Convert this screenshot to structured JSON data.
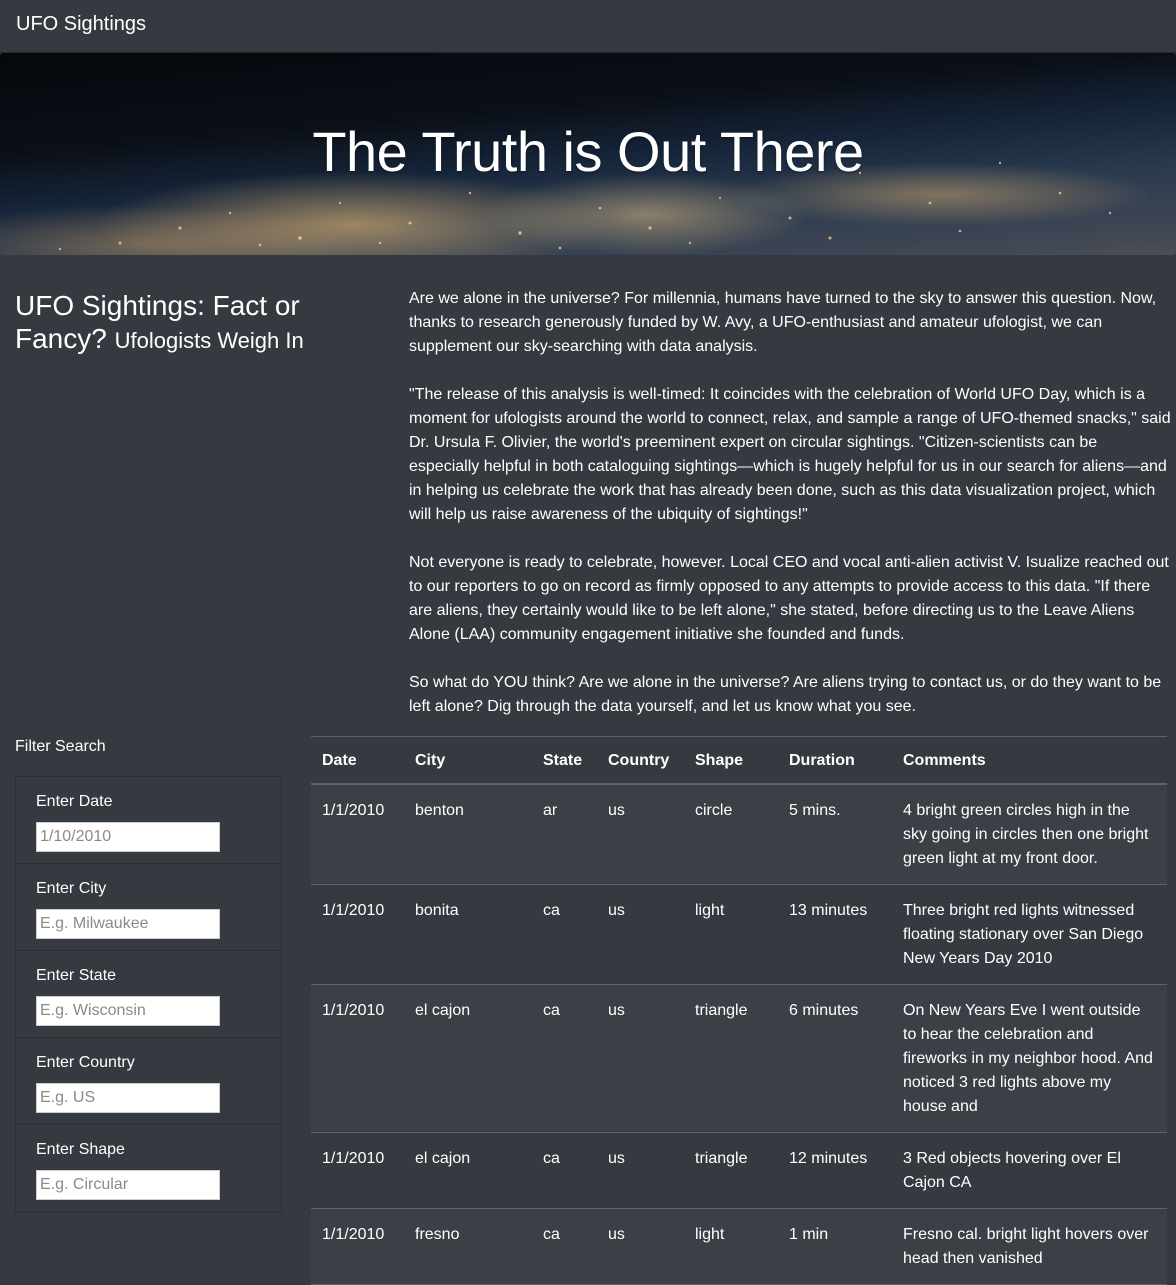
{
  "navbar": {
    "brand": "UFO Sightings"
  },
  "hero": {
    "title": "The Truth is Out There"
  },
  "article": {
    "heading": "UFO Sightings: Fact or Fancy?",
    "subheading": "Ufologists Weigh In",
    "paragraphs": [
      "Are we alone in the universe? For millennia, humans have turned to the sky to answer this question. Now, thanks to research generously funded by W. Avy, a UFO-enthusiast and amateur ufologist, we can supplement our sky-searching with data analysis.",
      "\"The release of this analysis is well-timed: It coincides with the celebration of World UFO Day, which is a moment for ufologists around the world to connect, relax, and sample a range of UFO-themed snacks,\" said Dr. Ursula F. Olivier, the world's preeminent expert on circular sightings. \"Citizen-scientists can be especially helpful in both cataloguing sightings—which is hugely helpful for us in our search for aliens—and in helping us celebrate the work that has already been done, such as this data visualization project, which will help us raise awareness of the ubiquity of sightings!\"",
      "Not everyone is ready to celebrate, however. Local CEO and vocal anti-alien activist V. Isualize reached out to our reporters to go on record as firmly opposed to any attempts to provide access to this data. \"If there are aliens, they certainly would like to be left alone,\" she stated, before directing us to the Leave Aliens Alone (LAA) community engagement initiative she founded and funds.",
      "So what do YOU think? Are we alone in the universe? Are aliens trying to contact us, or do they want to be left alone? Dig through the data yourself, and let us know what you see."
    ]
  },
  "filters": {
    "title": "Filter Search",
    "items": [
      {
        "label": "Enter Date",
        "placeholder": "1/10/2010",
        "value": ""
      },
      {
        "label": "Enter City",
        "placeholder": "E.g. Milwaukee",
        "value": ""
      },
      {
        "label": "Enter State",
        "placeholder": "E.g. Wisconsin",
        "value": ""
      },
      {
        "label": "Enter Country",
        "placeholder": "E.g. US",
        "value": ""
      },
      {
        "label": "Enter Shape",
        "placeholder": "E.g. Circular",
        "value": ""
      }
    ]
  },
  "table": {
    "headers": [
      "Date",
      "City",
      "State",
      "Country",
      "Shape",
      "Duration",
      "Comments"
    ],
    "rows": [
      [
        "1/1/2010",
        "benton",
        "ar",
        "us",
        "circle",
        "5 mins.",
        "4 bright green circles high in the sky going in circles then one bright green light at my front door."
      ],
      [
        "1/1/2010",
        "bonita",
        "ca",
        "us",
        "light",
        "13 minutes",
        "Three bright red lights witnessed floating stationary over San Diego New Years Day 2010"
      ],
      [
        "1/1/2010",
        "el cajon",
        "ca",
        "us",
        "triangle",
        "6 minutes",
        "On New Years Eve I went outside to hear the celebration and fireworks in my neighbor hood. And noticed 3 red lights above my house and"
      ],
      [
        "1/1/2010",
        "el cajon",
        "ca",
        "us",
        "triangle",
        "12 minutes",
        "3 Red objects hovering over El Cajon CA"
      ],
      [
        "1/1/2010",
        "fresno",
        "ca",
        "us",
        "light",
        "1 min",
        "Fresno cal. bright light hovers over head then vanished"
      ]
    ]
  }
}
